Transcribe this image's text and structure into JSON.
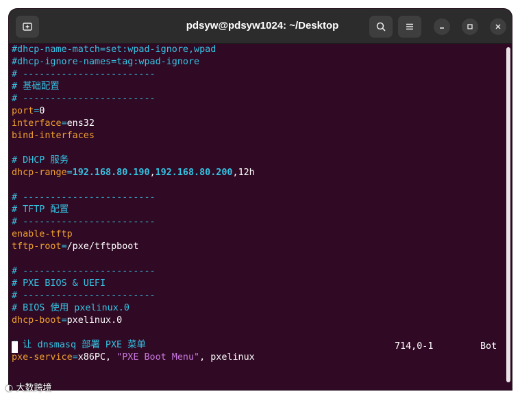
{
  "window": {
    "title": "pdsyw@pdsyw1024: ~/Desktop",
    "new_tab_icon": "new-tab-icon",
    "search_icon": "search-icon",
    "menu_icon": "hamburger-menu-icon",
    "minimize_icon": "minimize-icon",
    "maximize_icon": "maximize-icon",
    "close_icon": "close-icon"
  },
  "colors": {
    "terminal_bg": "#300a24",
    "comment": "#34c4e4",
    "key": "#f0a030",
    "string": "#c678dd",
    "text": "#ffffff"
  },
  "editor": {
    "lines": [
      {
        "segments": [
          {
            "t": "#dhcp-name-match=set:wpad-ignore,wpad",
            "c": "comment"
          }
        ]
      },
      {
        "segments": [
          {
            "t": "#dhcp-ignore-names=tag:wpad-ignore",
            "c": "comment"
          }
        ]
      },
      {
        "segments": [
          {
            "t": "# ------------------------",
            "c": "comment"
          }
        ]
      },
      {
        "segments": [
          {
            "t": "# 基础配置",
            "c": "comment"
          }
        ]
      },
      {
        "segments": [
          {
            "t": "# ------------------------",
            "c": "comment"
          }
        ]
      },
      {
        "segments": [
          {
            "t": "port",
            "c": "key"
          },
          {
            "t": "=",
            "c": "eq"
          },
          {
            "t": "0",
            "c": "val"
          }
        ]
      },
      {
        "segments": [
          {
            "t": "interface",
            "c": "key"
          },
          {
            "t": "=",
            "c": "eq"
          },
          {
            "t": "ens32",
            "c": "val"
          }
        ]
      },
      {
        "segments": [
          {
            "t": "bind-interfaces",
            "c": "key"
          }
        ]
      },
      {
        "segments": [
          {
            "t": "",
            "c": "val"
          }
        ]
      },
      {
        "segments": [
          {
            "t": "# DHCP 服务",
            "c": "comment"
          }
        ]
      },
      {
        "segments": [
          {
            "t": "dhcp-range",
            "c": "key"
          },
          {
            "t": "=",
            "c": "eq"
          },
          {
            "t": "192.168.80.190",
            "c": "num"
          },
          {
            "t": ",",
            "c": "val"
          },
          {
            "t": "192.168.80.200",
            "c": "num"
          },
          {
            "t": ",",
            "c": "val"
          },
          {
            "t": "12h",
            "c": "val"
          }
        ]
      },
      {
        "segments": [
          {
            "t": "",
            "c": "val"
          }
        ]
      },
      {
        "segments": [
          {
            "t": "# ------------------------",
            "c": "comment"
          }
        ]
      },
      {
        "segments": [
          {
            "t": "# TFTP 配置",
            "c": "comment"
          }
        ]
      },
      {
        "segments": [
          {
            "t": "# ------------------------",
            "c": "comment"
          }
        ]
      },
      {
        "segments": [
          {
            "t": "enable-tftp",
            "c": "key"
          }
        ]
      },
      {
        "segments": [
          {
            "t": "tftp-root",
            "c": "key"
          },
          {
            "t": "=",
            "c": "eq"
          },
          {
            "t": "/pxe/tftpboot",
            "c": "val"
          }
        ]
      },
      {
        "segments": [
          {
            "t": "",
            "c": "val"
          }
        ]
      },
      {
        "segments": [
          {
            "t": "# ------------------------",
            "c": "comment"
          }
        ]
      },
      {
        "segments": [
          {
            "t": "# PXE BIOS & UEFI",
            "c": "comment"
          }
        ]
      },
      {
        "segments": [
          {
            "t": "# ------------------------",
            "c": "comment"
          }
        ]
      },
      {
        "segments": [
          {
            "t": "# BIOS 使用 pxelinux.0",
            "c": "comment"
          }
        ]
      },
      {
        "segments": [
          {
            "t": "dhcp-boot",
            "c": "key"
          },
          {
            "t": "=",
            "c": "eq"
          },
          {
            "t": "pxelinux.0",
            "c": "val"
          }
        ]
      },
      {
        "segments": [
          {
            "t": "",
            "c": "val"
          }
        ]
      },
      {
        "segments": [
          {
            "t": "# 让 dnsmasq 部署 PXE 菜单",
            "c": "comment"
          }
        ]
      },
      {
        "segments": [
          {
            "t": "pxe-service",
            "c": "key"
          },
          {
            "t": "=",
            "c": "eq"
          },
          {
            "t": "x86PC, ",
            "c": "val"
          },
          {
            "t": "\"PXE Boot Menu\"",
            "c": "str"
          },
          {
            "t": ", pxelinux",
            "c": "val"
          }
        ]
      }
    ],
    "status_position": "714,0-1",
    "status_scroll": "Bot"
  },
  "watermark": {
    "text": "大数跨境"
  }
}
